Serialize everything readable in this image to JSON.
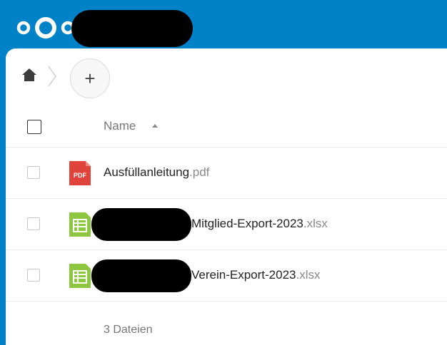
{
  "header": {
    "logo_icon": "nextcloud-logo-icon",
    "brand_color": "#0082c9"
  },
  "breadcrumb": {
    "home_icon": "home-icon",
    "add_label": "+"
  },
  "table": {
    "column_name": "Name",
    "sort": "ascending",
    "files": [
      {
        "name": "Ausfüllanleitung",
        "ext": ".pdf",
        "icon": "pdf-icon",
        "icon_label": "PDF",
        "icon_color": "#e0433a"
      },
      {
        "name": "Mitglied-Export-2023",
        "ext": ".xlsx",
        "icon": "spreadsheet-icon",
        "icon_color": "#8dc63f"
      },
      {
        "name": "Verein-Export-2023",
        "ext": ".xlsx",
        "icon": "spreadsheet-icon",
        "icon_color": "#8dc63f"
      }
    ]
  },
  "footer": {
    "count_label": "3 Dateien"
  }
}
